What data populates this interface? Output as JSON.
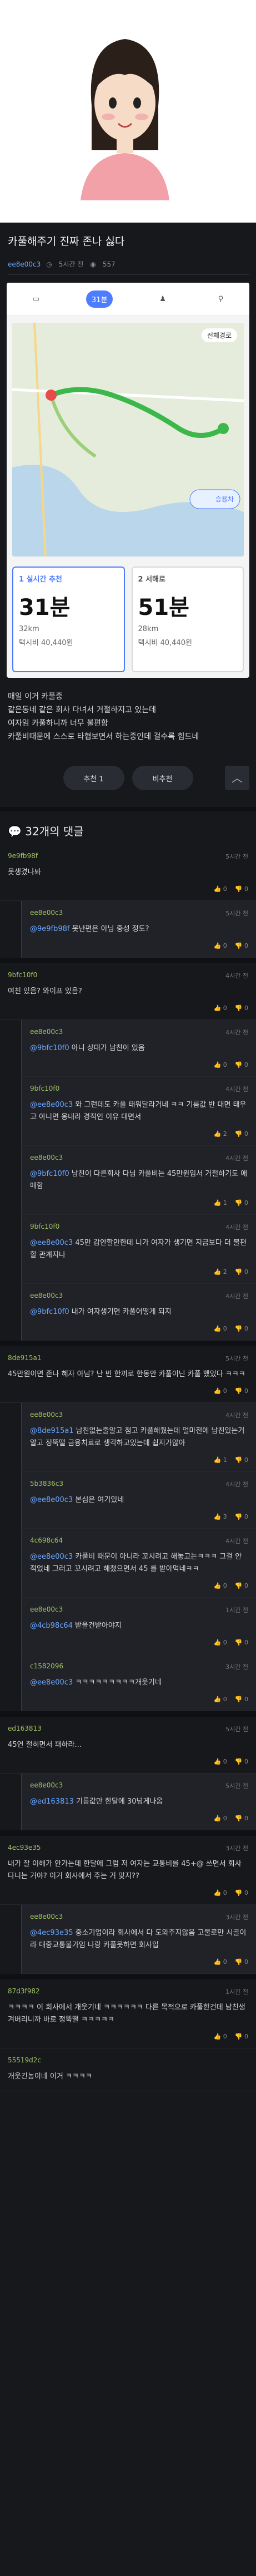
{
  "post": {
    "title": "카풀해주기 진짜 존나 싫다",
    "user": "ee8e00c3",
    "time": "5시간 전",
    "views": "557"
  },
  "app": {
    "tabs": [
      "31분",
      "",
      "",
      ""
    ],
    "route_chip": "전체경로",
    "car": "승용차",
    "card_a": {
      "label": "1 실시간 추천",
      "time": "31분",
      "dist": "32km",
      "fee": "택시비 40,440원"
    },
    "card_b": {
      "label": "2 서해로",
      "time": "51분",
      "dist": "28km",
      "fee": "택시비 40,440원"
    }
  },
  "body_lines": [
    "매일 이거 카풀중",
    "같은동네 같은 회사 다녀서 거절하지고 있는데",
    "여자임 카풀하니까 너무 불편함",
    "카풀비때문에 스스로 타협보면서 하는중인데 걸수록 힘드네"
  ],
  "votes": {
    "up": "추천 1",
    "down": "비추천"
  },
  "comments_header": "32개의 댓글",
  "comments": [
    {
      "user": "9e9fb98f",
      "time": "5시간 전",
      "text": "못생겼나봐",
      "up": "0",
      "down": "0"
    },
    {
      "user": "ee8e00c3",
      "time": "5시간 전",
      "mention": "@9e9fb98f",
      "text": "못난편은 아님 중성 정도?",
      "up": "0",
      "down": "0",
      "reply": true
    },
    {
      "user": "9bfc10f0",
      "time": "4시간 전",
      "text": "여친 있음? 와이프 있음?",
      "up": "0",
      "down": "0"
    },
    {
      "user": "ee8e00c3",
      "time": "4시간 전",
      "mention": "@9bfc10f0",
      "text": "아니 상대가 남친이 있음",
      "up": "0",
      "down": "0",
      "reply": true
    },
    {
      "user": "9bfc10f0",
      "time": "4시간 전",
      "mention": "@ee8e00c3",
      "text": "와 그런데도 카풀 태워달라거네 ㅋㅋ 기름값 반 대면 태우고 아니면 옹내라 경적인 이유 대면서",
      "up": "2",
      "down": "0",
      "reply": true
    },
    {
      "user": "ee8e00c3",
      "time": "4시간 전",
      "mention": "@9bfc10f0",
      "text": "남친이 다른회사 다님 카풀비는 45만원임서 거절하기도 애매함",
      "up": "1",
      "down": "0",
      "reply": true
    },
    {
      "user": "9bfc10f0",
      "time": "4시간 전",
      "mention": "@ee8e00c3",
      "text": "45만 감안할만한데 니가 여자가 생기면 지금보다 더 불편할 관계지나",
      "up": "2",
      "down": "0",
      "reply": true
    },
    {
      "user": "ee8e00c3",
      "time": "4시간 전",
      "mention": "@9bfc10f0",
      "text": "내가 여자생기면 카풀어떻게 되지",
      "up": "0",
      "down": "0",
      "reply": true
    },
    {
      "user": "8de915a1",
      "time": "5시간 전",
      "text": "45만원이면 존나 혜자 아님? 난 빈 한끼로 한동안 카풀이닌 카풀 했었다 ㅋㅋㅋ",
      "up": "0",
      "down": "0"
    },
    {
      "user": "ee8e00c3",
      "time": "4시간 전",
      "mention": "@8de915a1",
      "text": "남친없는줄알고 첨고 카풀해줬는데 얼마전에 남친있는거알고 정뚝떨 금융치료로 생각하고있는데 쉽지가않아",
      "up": "1",
      "down": "0",
      "reply": true
    },
    {
      "user": "5b3836c3",
      "time": "4시간 전",
      "mention": "@ee8e00c3",
      "text": "본심은 여기있네",
      "up": "3",
      "down": "0",
      "reply": true
    },
    {
      "user": "4c698c64",
      "time": "4시간 전",
      "mention": "@ee8e00c3",
      "text": "카풀비 때문이 아니라 꼬시려고 해놓고는ㅋㅋㅋ 그걸 안적었네 그러고 꼬시려고 해쳤으면서 45 를 받아먹네ㅋㅋ",
      "up": "0",
      "down": "0",
      "reply": true
    },
    {
      "user": "ee8e00c3",
      "time": "1시간 전",
      "mention": "@4cb98c64",
      "text": "받을건받아야지",
      "up": "0",
      "down": "0",
      "reply": true
    },
    {
      "user": "c1582096",
      "time": "3시간 전",
      "mention": "@ee8e00c3",
      "text": "ㅋㅋㅋㅋㅋㅋㅋㅋㅋ개웃기네",
      "up": "0",
      "down": "0",
      "reply": true
    },
    {
      "user": "ed163813",
      "time": "5시간 전",
      "text": "45연 절히면서 꽤하라...",
      "up": "0",
      "down": "0"
    },
    {
      "user": "ee8e00c3",
      "time": "5시간 전",
      "mention": "@ed163813",
      "text": "기름값만 한달에 30넘게나옴",
      "up": "0",
      "down": "0",
      "reply": true
    },
    {
      "user": "4ec93e35",
      "time": "3시간 전",
      "text": "내가 잘 이해가 안가는데 한달에 그럼 저 여자는 교통비를 45+@ 쓰면서 회사 다니는 거야? 이거 회사에서 주는 거 맞지??",
      "up": "0",
      "down": "0"
    },
    {
      "user": "ee8e00c3",
      "time": "3시간 전",
      "mention": "@4ec93e35",
      "text": "중소기업이라 회사에서 다 도와주지않음 고물로만 시골이라 대중교통불가임 나랑 카풀못하면 회사입",
      "up": "0",
      "down": "0",
      "reply": true
    },
    {
      "user": "87d3f982",
      "time": "1시간 전",
      "text": "ㅋㅋㅋㅋ 이 회사에서 개웃기네 ㅋㅋㅋㅋㅋㅋ 다른 목적으로 카풀한건데 남친생겨버리니까 바로 정뚝떨 ㅋㅋㅋㅋㅋ",
      "up": "0",
      "down": "0"
    },
    {
      "user": "55519d2c",
      "time": "",
      "text": "개웃긴놈이네 이거 ㅋㅋㅋㅋ",
      "up": "",
      "down": ""
    }
  ]
}
